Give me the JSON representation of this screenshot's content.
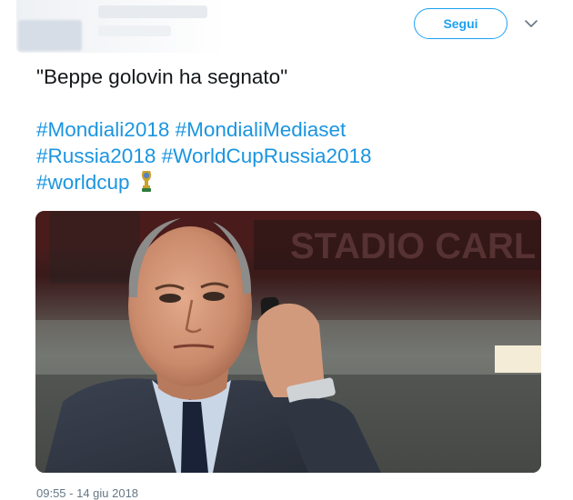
{
  "header": {
    "follow_label": "Segui",
    "menu_icon": "chevron-down-icon"
  },
  "tweet": {
    "quote": "\"Beppe golovin ha segnato\"",
    "hashtags": [
      "#Mondiali2018",
      "#MondialiMediaset",
      "#Russia2018",
      "#WorldCupRussia2018",
      "#worldcup"
    ],
    "emoji_icon": "world-cup-trophy-icon",
    "photo_background_text": "STADIO CARL"
  },
  "footer": {
    "timestamp": "09:55 - 14 giu 2018"
  },
  "colors": {
    "accent": "#1da1f2",
    "hashtag": "#1b95e0",
    "text": "#14171a",
    "muted": "#657786"
  }
}
